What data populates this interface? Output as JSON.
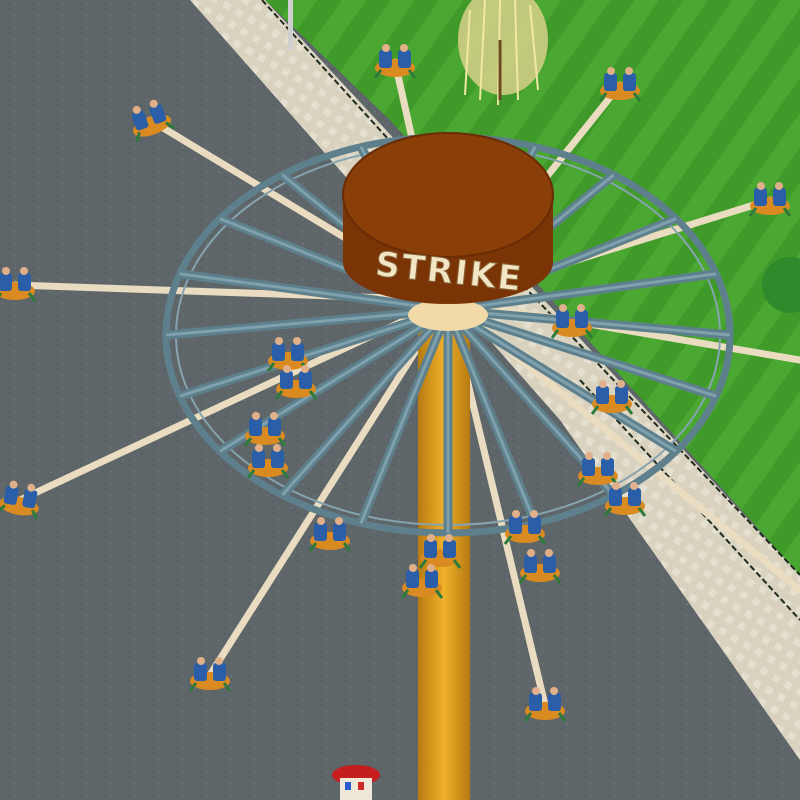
{
  "sign": {
    "text": "STRIKE"
  },
  "colors": {
    "asphalt": "#5f6669",
    "grass": "#3f9a2a",
    "grass_light": "#58b83a",
    "path": "#d8d2bf",
    "tower": "#e3a21a",
    "hub_top": "#8a3e08",
    "hub_side": "#7a3406",
    "frame": "#5e7f8c",
    "arm": "#e9dcc0",
    "seat": "#2b5ea8",
    "seat_accent": "#d98a20"
  },
  "icons": {
    "tree": "willow-tree-icon",
    "kiosk": "ticket-booth-icon"
  }
}
